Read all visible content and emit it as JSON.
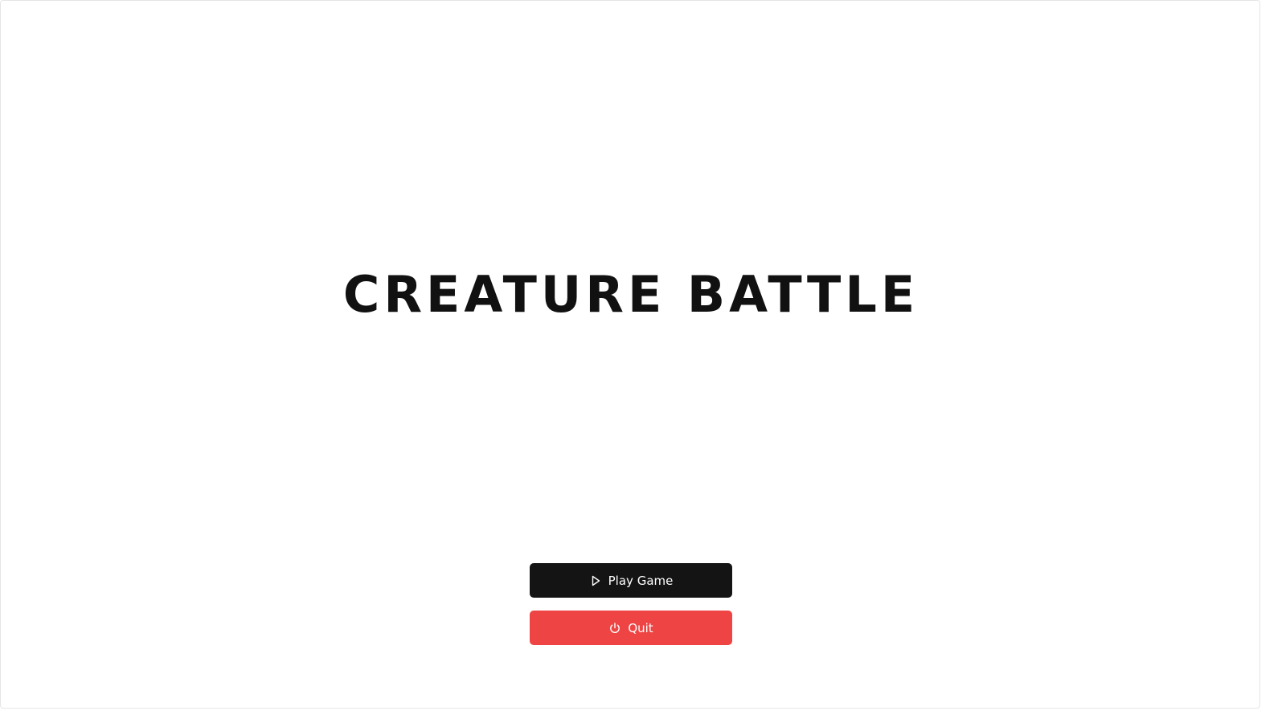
{
  "game": {
    "title": "CREATURE BATTLE"
  },
  "menu": {
    "play_label": "Play Game",
    "play_icon": "play-icon",
    "quit_label": "Quit",
    "quit_icon": "power-icon"
  },
  "colors": {
    "title_text": "#111111",
    "play_button_bg": "#141414",
    "quit_button_bg": "#ef4444",
    "button_text": "#ffffff"
  }
}
